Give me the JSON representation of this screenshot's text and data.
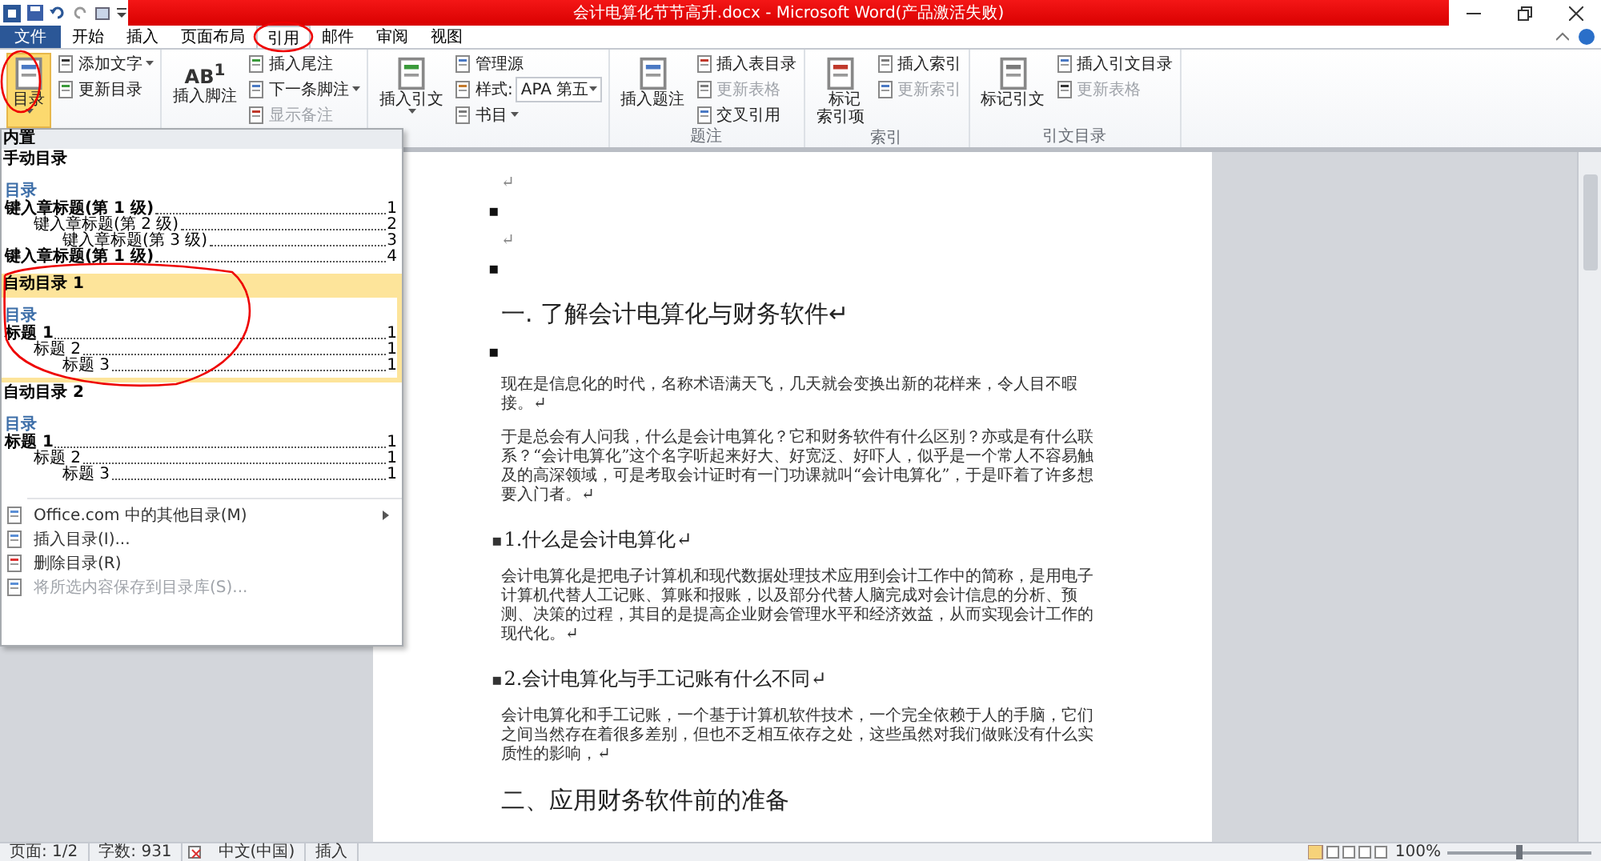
{
  "title_bar": {
    "title": "会计电算化节节高升.docx - Microsoft Word(产品激活失败)"
  },
  "tabs": [
    {
      "label": "文件",
      "kind": "file",
      "selected": false
    },
    {
      "label": "开始",
      "kind": "tab",
      "selected": false
    },
    {
      "label": "插入",
      "kind": "tab",
      "selected": false
    },
    {
      "label": "页面布局",
      "kind": "tab",
      "selected": false
    },
    {
      "label": "引用",
      "kind": "tab",
      "selected": true
    },
    {
      "label": "邮件",
      "kind": "tab",
      "selected": false
    },
    {
      "label": "审阅",
      "kind": "tab",
      "selected": false
    },
    {
      "label": "视图",
      "kind": "tab",
      "selected": false
    }
  ],
  "ribbon": {
    "groups": [
      {
        "items": [
          {
            "kind": "big",
            "label": "目录",
            "pressed": true,
            "dropdown": true,
            "disabled": false
          },
          {
            "kind": "small",
            "label": "添加文字",
            "dropdown": true,
            "disabled": false
          },
          {
            "kind": "small",
            "label": "更新目录",
            "dropdown": false,
            "disabled": false
          }
        ]
      },
      {
        "items": [
          {
            "kind": "big",
            "label": "插入脚注",
            "icon_text": "AB$^{1}$",
            "pressed": false,
            "dropdown": false,
            "disabled": false
          },
          {
            "kind": "small",
            "label": "插入尾注",
            "dropdown": false,
            "disabled": false
          },
          {
            "kind": "small",
            "label": "下一条脚注",
            "dropdown": true,
            "disabled": false
          },
          {
            "kind": "small",
            "label": "显示备注",
            "dropdown": false,
            "disabled": true
          }
        ]
      },
      {
        "items": [
          {
            "kind": "big",
            "label": "插入引文",
            "pressed": false,
            "dropdown": true,
            "disabled": false
          },
          {
            "kind": "small",
            "label": "管理源",
            "dropdown": false,
            "disabled": false
          },
          {
            "kind": "select",
            "label": "样式:",
            "value": "APA 第五",
            "dropdown": true,
            "disabled": false
          },
          {
            "kind": "small",
            "label": "书目",
            "dropdown": true,
            "disabled": false
          }
        ]
      },
      {
        "label": "题注",
        "items": [
          {
            "kind": "big",
            "label": "插入题注",
            "pressed": false,
            "dropdown": false,
            "disabled": false
          },
          {
            "kind": "small",
            "label": "插入表目录",
            "dropdown": false,
            "disabled": false
          },
          {
            "kind": "small",
            "label": "更新表格",
            "dropdown": false,
            "disabled": true
          },
          {
            "kind": "small",
            "label": "交叉引用",
            "dropdown": false,
            "disabled": false
          }
        ]
      },
      {
        "label": "索引",
        "items": [
          {
            "kind": "big",
            "label": "标记索引项",
            "pressed": false,
            "dropdown": false,
            "disabled": false
          },
          {
            "kind": "small",
            "label": "插入索引",
            "dropdown": false,
            "disabled": false
          },
          {
            "kind": "small",
            "label": "更新索引",
            "dropdown": false,
            "disabled": true
          }
        ]
      },
      {
        "label": "引文目录",
        "items": [
          {
            "kind": "big",
            "label": "标记引文",
            "pressed": false,
            "dropdown": false,
            "disabled": false
          },
          {
            "kind": "small",
            "label": "插入引文目录",
            "dropdown": false,
            "disabled": false
          },
          {
            "kind": "small",
            "label": "更新表格",
            "dropdown": false,
            "disabled": true
          }
        ]
      }
    ]
  },
  "toc_menu": {
    "section": "内置",
    "entries": [
      {
        "title": "手动目录",
        "selected": false,
        "heading": "目录",
        "lines": [
          {
            "text": "键入章标题(第 1 级)",
            "page": "1",
            "children": [
              {
                "text": "键入章标题(第 2 级)",
                "page": "2",
                "children": [
                  {
                    "text": "键入章标题(第 3 级)",
                    "page": "3"
                  }
                ]
              }
            ]
          },
          {
            "text": "键入章标题(第 1 级)",
            "page": "4"
          }
        ]
      },
      {
        "title": "自动目录 1",
        "selected": true,
        "heading": "目录",
        "lines": [
          {
            "text": "标题 1",
            "page": "1",
            "children": [
              {
                "text": "标题 2",
                "page": "1",
                "children": [
                  {
                    "text": "标题 3",
                    "page": "1"
                  }
                ]
              }
            ]
          }
        ]
      },
      {
        "title": "自动目录 2",
        "selected": false,
        "heading": "目录",
        "lines": [
          {
            "text": "标题 1",
            "page": "1",
            "children": [
              {
                "text": "标题 2",
                "page": "1",
                "children": [
                  {
                    "text": "标题 3",
                    "page": "1"
                  }
                ]
              }
            ]
          }
        ]
      }
    ],
    "commands": [
      {
        "label": "Office.com 中的其他目录(M)",
        "disabled": false,
        "submenu": true
      },
      {
        "label": "插入目录(I)...",
        "disabled": false,
        "submenu": false
      },
      {
        "label": "删除目录(R)",
        "disabled": false,
        "submenu": false
      },
      {
        "label": "将所选内容保存到目录库(S)...",
        "disabled": true,
        "submenu": false
      }
    ]
  },
  "document": {
    "blocks": [
      {
        "kind": "return",
        "text": "↵"
      },
      {
        "kind": "bullet",
        "text": "▪"
      },
      {
        "kind": "return",
        "text": "↵"
      },
      {
        "kind": "bullet",
        "text": "▪"
      },
      {
        "kind": "heading1",
        "text": "一.  了解会计电算化与财务软件↵"
      },
      {
        "kind": "bullet",
        "text": "▪"
      },
      {
        "kind": "para",
        "text": "现在是信息化的时代，名称术语满天飞，几天就会变换出新的花样来，令人目不暇接。↵"
      },
      {
        "kind": "para",
        "text": "于是总会有人问我，什么是会计电算化？它和财务软件有什么区别？亦或是有什么联系？“会计电算化”这个名字听起来好大、好宽泛、好吓人，似乎是一个常人不容易触及的高深领域，可是考取会计证时有一门功课就叫“会计电算化”，于是吓着了许多想要入门者。↵"
      },
      {
        "kind": "heading2",
        "marker": "▪",
        "text": "1.什么是会计电算化↵"
      },
      {
        "kind": "para",
        "text": "会计电算化是把电子计算机和现代数据处理技术应用到会计工作中的简称，是用电子计算机代替人工记账、算账和报账，以及部分代替人脑完成对会计信息的分析、预测、决策的过程，其目的是提高企业财会管理水平和经济效益，从而实现会计工作的现代化。↵"
      },
      {
        "kind": "heading2",
        "marker": "▪",
        "text": "2.会计电算化与手工记账有什么不同↵"
      },
      {
        "kind": "para",
        "text": "会计电算化和手工记账，一个基于计算机软件技术，一个完全依赖于人的手脑，它们之间当然存在着很多差别，但也不乏相互依存之处，这些虽然对我们做账没有什么实质性的影响，↵"
      },
      {
        "kind": "heading1",
        "text": "二、应用财务软件前的准备"
      }
    ]
  },
  "status_bar": {
    "page": "页面: 1/2",
    "words": "字数: 931",
    "language": "中文(中国)",
    "mode": "插入",
    "zoom": "100%",
    "zoom_slider": {
      "level": 0.5
    }
  }
}
